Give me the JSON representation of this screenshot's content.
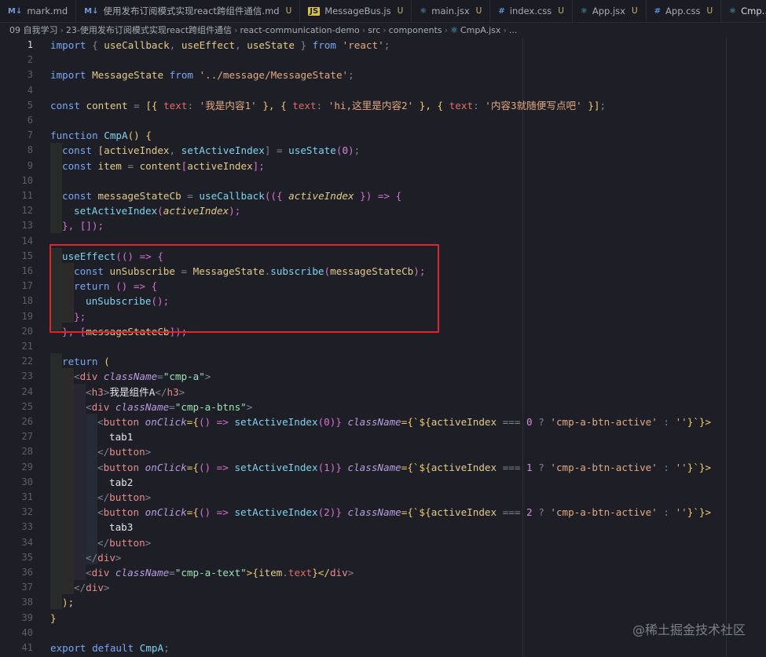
{
  "tabs": [
    {
      "icon": "markdown-icon",
      "label": "mark.md",
      "status": ""
    },
    {
      "icon": "markdown-icon",
      "label": "使用发布订阅模式实现react跨组件通信.md",
      "status": "U"
    },
    {
      "icon": "javascript-icon",
      "label": "MessageBus.js",
      "status": "U"
    },
    {
      "icon": "react-icon",
      "label": "main.jsx",
      "status": "U"
    },
    {
      "icon": "css-icon",
      "label": "index.css",
      "status": "U"
    },
    {
      "icon": "react-icon",
      "label": "App.jsx",
      "status": "U"
    },
    {
      "icon": "css-icon",
      "label": "App.css",
      "status": "U"
    },
    {
      "icon": "react-icon",
      "label": "Cmp...",
      "status": ""
    }
  ],
  "breadcrumb": [
    "09 自我学习",
    "23-使用发布订阅模式实现react跨组件通信",
    "react-communication-demo",
    "src",
    "components",
    "CmpA.jsx",
    "..."
  ],
  "editor": {
    "line_numbers": [
      "1",
      "2",
      "3",
      "4",
      "5",
      "6",
      "7",
      "8",
      "9",
      "10",
      "11",
      "12",
      "13",
      "14",
      "15",
      "16",
      "17",
      "18",
      "19",
      "20",
      "21",
      "22",
      "23",
      "24",
      "25",
      "26",
      "27",
      "28",
      "29",
      "30",
      "31",
      "32",
      "33",
      "34",
      "35",
      "36",
      "37",
      "38",
      "39",
      "40",
      "41"
    ],
    "code": {
      "l1_import": "import",
      "l1_rest1": " { ",
      "l1_a": "useCallback",
      "l1_c1": ", ",
      "l1_b": "useEffect",
      "l1_c2": ", ",
      "l1_c": "useState",
      "l1_rest2": " } ",
      "l1_from": "from",
      "l1_mod": " 'react'",
      "l1_end": ";",
      "l3_import": "import",
      "l3_name": " MessageState ",
      "l3_from": "from",
      "l3_mod": " '../message/MessageState'",
      "l3_end": ";",
      "l5_const": "const",
      "l5_name": " content",
      "l5_eq": " = ",
      "l5_open": "[{ ",
      "l5_k1": "text",
      "l5_c1": ": ",
      "l5_s1": "'我是内容1'",
      "l5_m1": " }, { ",
      "l5_k2": "text",
      "l5_c2": ": ",
      "l5_s2": "'hi,这里是内容2'",
      "l5_m2": " }, { ",
      "l5_k3": "text",
      "l5_c3": ": ",
      "l5_s3": "'内容3就随便写点吧'",
      "l5_close": " }]",
      ";": ";",
      "l7_fn": "function",
      "l7_name": " CmpA",
      "l7_rest": "() {",
      "l8_const": "const",
      "l8_a": " [activeIndex",
      "l8_c": ", ",
      "l8_b": "setActiveIndex",
      "l8_c2": "] = ",
      "l8_fn": "useState",
      "l8_p1": "(",
      "l8_num": "0",
      "l8_p2": ")",
      "l9_const": "const",
      "l9_name": " item",
      "l9_eq": " = ",
      "l9_obj": "content",
      "l9_b1": "[",
      "l9_idx": "activeIndex",
      "l9_b2": "];",
      "l11_const": "const",
      "l11_name": " messageStateCb",
      "l11_eq": " = ",
      "l11_fn": "useCallback",
      "l11_p": "(({ ",
      "l11_arg": "activeIndex",
      "l11_q": " }) => {",
      "l12_fn": "setActiveIndex",
      "l12_p1": "(",
      "l12_arg": "activeIndex",
      "l12_p2": ");",
      "l13": "}, []);",
      "l15_fn": "useEffect",
      "l15_rest": "(() => {",
      "l16_const": "const",
      "l16_name": " unSubscribe",
      "l16_eq": " = ",
      "l16_obj": "MessageState",
      "l16_dot": ".",
      "l16_m": "subscribe",
      "l16_p1": "(",
      "l16_arg": "messageStateCb",
      "l16_p2": ");",
      "l17_ret": "return",
      "l17_rest": " () => {",
      "l18_fn": "unSubscribe",
      "l18_rest": "();",
      "l19": "};",
      "l20_a": "}, [",
      "l20_arg": "messageStateCb",
      "l20_b": "]);",
      "l22_ret": "return",
      "l22_rest": " (",
      "l23_o": "<",
      "l23_tag": "div",
      "l23_attr": " className",
      "l23_eq": "=",
      "l23_val": "\"cmp-a\"",
      "l23_c": ">",
      "l24_o": "<",
      "l24_tag": "h3",
      "l24_c": ">",
      "l24_txt": "我是组件A",
      "l24_o2": "</",
      "l24_tag2": "h3",
      "l24_c2": ">",
      "l25_o": "<",
      "l25_tag": "div",
      "l25_attr": " className",
      "l25_eq": "=",
      "l25_val": "\"cmp-a-btns\"",
      "l25_c": ">",
      "btn_o": "<",
      "btn_tag": "button",
      "btn_onclick": " onClick",
      "btn_eq": "={",
      "btn_arrow": "() => ",
      "btn_fn": "setActiveIndex",
      "btn_cn": " className",
      "btn_cn_eq": "={`${",
      "btn_var": "activeIndex",
      "btn_cmp": " === ",
      "btn_q": " ? ",
      "btn_active": "'cmp-a-btn-active'",
      "btn_colon": " : ",
      "btn_empty": "''",
      "btn_end": "}`}>",
      "l26_arg": "(0)}",
      "l26_num": "0",
      "l27": "tab1",
      "btn_close": "</",
      "btn_close_tag": "button",
      "btn_close_end": ">",
      "l29_arg": "(1)}",
      "l29_num": "1",
      "l30": "tab2",
      "l32_arg": "(2)}",
      "l32_num": "2",
      "l33": "tab3",
      "l35_o": "</",
      "l35_tag": "div",
      "l35_c": ">",
      "l36_o": "<",
      "l36_tag": "div",
      "l36_attr": " className",
      "l36_eq": "=",
      "l36_val": "\"cmp-a-text\"",
      "l36_b": ">{",
      "l36_obj": "item",
      "l36_dot": ".",
      "l36_k": "text",
      "l36_e": "}</",
      "l36_tag2": "div",
      "l36_c": ">",
      "l37_o": "</",
      "l37_tag": "div",
      "l37_c": ">",
      "l38": ");",
      "l39": "}",
      "l41_exp": "export",
      "l41_def": " default",
      "l41_name": " CmpA"
    }
  },
  "watermark": "@稀土掘金技术社区"
}
